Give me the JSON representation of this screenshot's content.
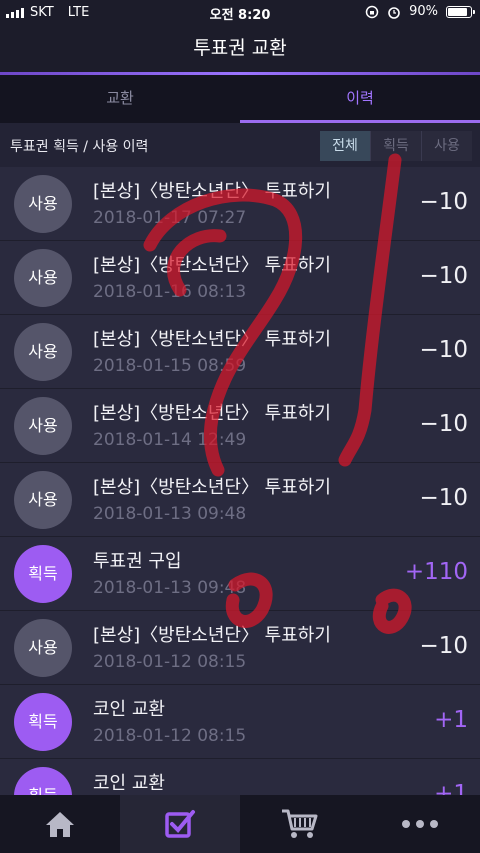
{
  "status": {
    "carrier": "SKT",
    "network": "LTE",
    "time": "오전 8:20",
    "battery": "90%",
    "battery_level": 0.9
  },
  "header": {
    "title": "투표권 교환"
  },
  "tabs": [
    {
      "label": "교환",
      "active": false
    },
    {
      "label": "이력",
      "active": true
    }
  ],
  "filter": {
    "title": "투표권 획득 / 사용 이력",
    "options": [
      "전체",
      "획득",
      "사용"
    ],
    "selected": "전체"
  },
  "history": [
    {
      "type": "사용",
      "title": "[본상]〈방탄소년단〉 투표하기",
      "date": "2018-01-17 07:27",
      "amount": "−10"
    },
    {
      "type": "사용",
      "title": "[본상]〈방탄소년단〉 투표하기",
      "date": "2018-01-16 08:13",
      "amount": "−10"
    },
    {
      "type": "사용",
      "title": "[본상]〈방탄소년단〉 투표하기",
      "date": "2018-01-15 08:59",
      "amount": "−10"
    },
    {
      "type": "사용",
      "title": "[본상]〈방탄소년단〉 투표하기",
      "date": "2018-01-14 12:49",
      "amount": "−10"
    },
    {
      "type": "사용",
      "title": "[본상]〈방탄소년단〉 투표하기",
      "date": "2018-01-13 09:48",
      "amount": "−10"
    },
    {
      "type": "획득",
      "title": "투표권 구입",
      "date": "2018-01-13 09:48",
      "amount": "+110"
    },
    {
      "type": "사용",
      "title": "[본상]〈방탄소년단〉 투표하기",
      "date": "2018-01-12 08:15",
      "amount": "−10"
    },
    {
      "type": "획득",
      "title": "코인 교환",
      "date": "2018-01-12 08:15",
      "amount": "+1"
    },
    {
      "type": "획득",
      "title": "코인 교환",
      "date": "",
      "amount": "+1"
    }
  ],
  "nav": [
    {
      "icon": "home-icon",
      "active": false
    },
    {
      "icon": "vote-check-icon",
      "active": true
    },
    {
      "icon": "cart-icon",
      "active": false
    },
    {
      "icon": "more-icon",
      "active": false
    }
  ],
  "colors": {
    "accent": "#9d5cf2",
    "scribble": "#d8182a"
  }
}
